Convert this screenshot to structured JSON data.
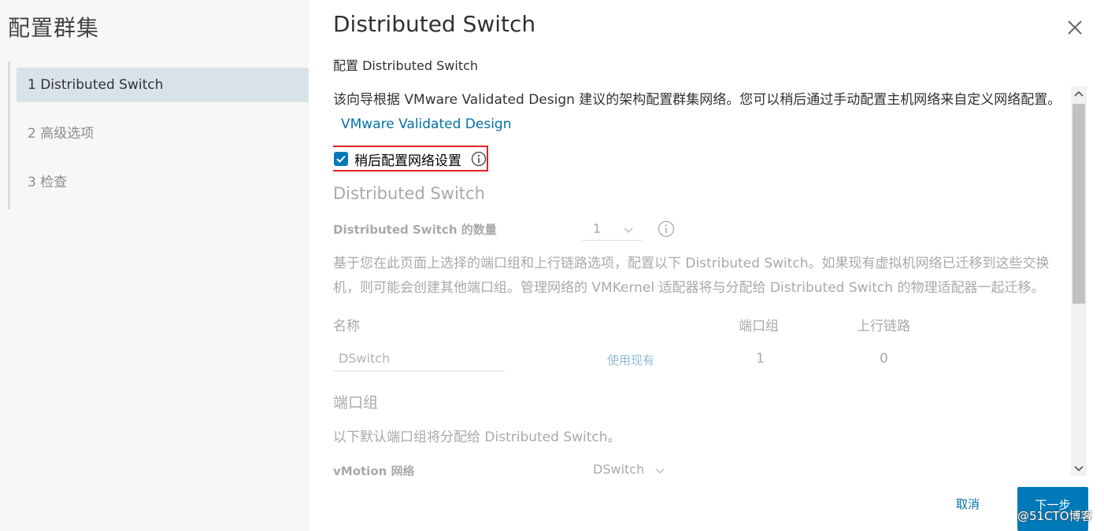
{
  "wizard": {
    "title": "配置群集",
    "steps": [
      {
        "label": "1  Distributed Switch",
        "active": true
      },
      {
        "label": "2  高级选项",
        "active": false
      },
      {
        "label": "3  检查",
        "active": false
      }
    ]
  },
  "main": {
    "title": "Distributed Switch",
    "subtitle": "配置 Distributed Switch",
    "intro_text": "该向导根据 VMware Validated Design 建议的架构配置群集网络。您可以稍后通过手动配置主机网络来自定义网络配置。",
    "intro_link": "VMware Validated Design",
    "configure_later": {
      "label": "稍后配置网络设置",
      "checked": true
    },
    "section_heading": "Distributed Switch",
    "switch_count": {
      "label": "Distributed Switch 的数量",
      "value": "1"
    },
    "description": "基于您在此页面上选择的端口组和上行链路选项，配置以下 Distributed Switch。如果现有虚拟机网络已迁移到这些交换机，则可能会创建其他端口组。管理网络的 VMKernel 适配器将与分配给 Distributed Switch 的物理适配器一起迁移。",
    "table": {
      "headers": {
        "name": "名称",
        "port_groups": "端口组",
        "uplinks": "上行链路"
      },
      "row": {
        "name_placeholder": "DSwitch",
        "use_existing": "使用现有",
        "port_groups": "1",
        "uplinks": "0"
      }
    },
    "port_group_heading": "端口组",
    "port_group_desc": "以下默认端口组将分配给 Distributed Switch。",
    "vmotion": {
      "label": "vMotion 网络",
      "value": "DSwitch"
    }
  },
  "footer": {
    "cancel": "取消",
    "next": "下一步",
    "watermark": "@51CTO博客"
  },
  "colors": {
    "accent": "#0079b8",
    "highlight_border": "#e02020"
  }
}
